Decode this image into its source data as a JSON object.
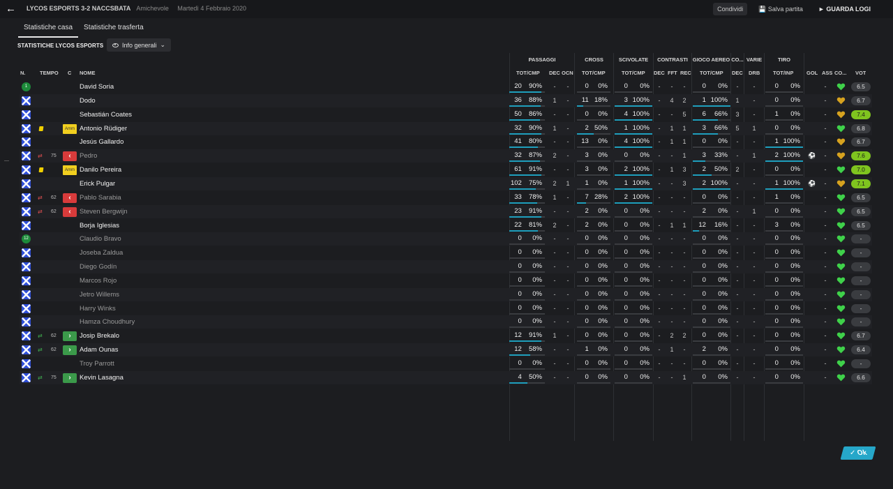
{
  "header": {
    "match_title": "LYCOS ESPORTS 3-2 NACCSBATA",
    "match_type": "Amichevole",
    "match_date": "Martedì 4 Febbraio 2020",
    "share_label": "Condividi",
    "save_label": "Salva partita",
    "watch_label": "GUARDA LOGI"
  },
  "tabs": [
    {
      "label": "Statistiche casa",
      "active": true
    },
    {
      "label": "Statistiche trasferta",
      "active": false
    }
  ],
  "section_title": "STATISTICHE LYCOS ESPORTS",
  "view_dropdown": {
    "label": "Info generali"
  },
  "groups": {
    "passaggi": "PASSAGGI",
    "cross": "CROSS",
    "scivolate": "SCIVOLATE",
    "contrasti": "CONTRASTI",
    "gioco_aereo": "GIOCO AEREO",
    "co": "CO...",
    "varie": "VARIE",
    "tiro": "TIRO"
  },
  "columns": {
    "n": "N.",
    "tempo": "TEMPO",
    "c": "C",
    "nome": "NOME",
    "pass_totcmp": "TOT/CMP",
    "pass_dec": "DEC",
    "pass_ocn": "OCN",
    "cross_totcmp": "TOT/CMP",
    "sciv_totcmp": "TOT/CMP",
    "contr_dec": "DEC",
    "contr_fft": "FFT",
    "contr_rec": "REC",
    "aereo_totcmp": "TOT/CMP",
    "co_dec": "DEC",
    "varie_drb": "DRB",
    "tiro_totinp": "TOT/INP",
    "gol": "GOL",
    "ass": "ASS",
    "co": "CO...",
    "vot": "VOT"
  },
  "colors": {
    "bar": "#1e9fbd",
    "rating_good": "#7fc41f",
    "heart_green": "#3fd14a",
    "heart_gold": "#d6a21f",
    "sub_out": "#d83b3b",
    "sub_in": "#3b9a4a"
  },
  "players": [
    {
      "num_badge": "1",
      "tempo_icon": "",
      "minute": "",
      "c": "",
      "name": "David Soria",
      "dim": false,
      "pass": [
        "20",
        "90%"
      ],
      "pass_pct": 90,
      "pass_dec": "-",
      "pass_ocn": "-",
      "cross": [
        "0",
        "0%"
      ],
      "cross_pct": 0,
      "sciv": [
        "0",
        "0%"
      ],
      "sciv_pct": 0,
      "c_dec": "-",
      "c_fft": "-",
      "c_rec": "-",
      "aereo": [
        "0",
        "0%"
      ],
      "aereo_pct": 0,
      "co_dec": "-",
      "drb": "-",
      "tiro": [
        "0",
        "0%"
      ],
      "tiro_pct": 0,
      "gol": "",
      "ass": "-",
      "heart": "green",
      "vot": "6.5",
      "vot_good": false
    },
    {
      "num_badge": "",
      "tempo_icon": "",
      "minute": "",
      "c": "",
      "name": "Dodo",
      "dim": false,
      "pass": [
        "36",
        "88%"
      ],
      "pass_pct": 88,
      "pass_dec": "1",
      "pass_ocn": "-",
      "cross": [
        "11",
        "18%"
      ],
      "cross_pct": 18,
      "sciv": [
        "3",
        "100%"
      ],
      "sciv_pct": 100,
      "c_dec": "-",
      "c_fft": "4",
      "c_rec": "2",
      "aereo": [
        "1",
        "100%"
      ],
      "aereo_pct": 100,
      "co_dec": "1",
      "drb": "-",
      "tiro": [
        "0",
        "0%"
      ],
      "tiro_pct": 0,
      "gol": "",
      "ass": "-",
      "heart": "gold",
      "vot": "6.7",
      "vot_good": false
    },
    {
      "num_badge": "",
      "tempo_icon": "",
      "minute": "",
      "c": "",
      "name": "Sebastián Coates",
      "dim": false,
      "pass": [
        "50",
        "86%"
      ],
      "pass_pct": 86,
      "pass_dec": "-",
      "pass_ocn": "-",
      "cross": [
        "0",
        "0%"
      ],
      "cross_pct": 0,
      "sciv": [
        "4",
        "100%"
      ],
      "sciv_pct": 100,
      "c_dec": "-",
      "c_fft": "-",
      "c_rec": "5",
      "aereo": [
        "6",
        "66%"
      ],
      "aereo_pct": 66,
      "co_dec": "3",
      "drb": "-",
      "tiro": [
        "1",
        "0%"
      ],
      "tiro_pct": 0,
      "gol": "",
      "ass": "-",
      "heart": "gold",
      "vot": "7.4",
      "vot_good": true
    },
    {
      "num_badge": "",
      "tempo_icon": "yellow",
      "minute": "",
      "c": "Amm",
      "name": "Antonio Rüdiger",
      "dim": false,
      "pass": [
        "32",
        "90%"
      ],
      "pass_pct": 90,
      "pass_dec": "1",
      "pass_ocn": "-",
      "cross": [
        "2",
        "50%"
      ],
      "cross_pct": 50,
      "sciv": [
        "1",
        "100%"
      ],
      "sciv_pct": 100,
      "c_dec": "-",
      "c_fft": "1",
      "c_rec": "1",
      "aereo": [
        "3",
        "66%"
      ],
      "aereo_pct": 66,
      "co_dec": "5",
      "drb": "1",
      "tiro": [
        "0",
        "0%"
      ],
      "tiro_pct": 0,
      "gol": "",
      "ass": "-",
      "heart": "green",
      "vot": "6.8",
      "vot_good": false
    },
    {
      "num_badge": "",
      "tempo_icon": "",
      "minute": "",
      "c": "",
      "name": "Jesús Gallardo",
      "dim": false,
      "pass": [
        "41",
        "80%"
      ],
      "pass_pct": 80,
      "pass_dec": "-",
      "pass_ocn": "-",
      "cross": [
        "13",
        "0%"
      ],
      "cross_pct": 0,
      "sciv": [
        "4",
        "100%"
      ],
      "sciv_pct": 100,
      "c_dec": "-",
      "c_fft": "1",
      "c_rec": "1",
      "aereo": [
        "0",
        "0%"
      ],
      "aereo_pct": 0,
      "co_dec": "-",
      "drb": "-",
      "tiro": [
        "1",
        "100%"
      ],
      "tiro_pct": 100,
      "gol": "",
      "ass": "-",
      "heart": "gold",
      "vot": "6.7",
      "vot_good": false
    },
    {
      "num_badge": "",
      "tempo_icon": "out",
      "minute": "75",
      "c": "out",
      "name": "Pedro",
      "dim": true,
      "pass": [
        "32",
        "87%"
      ],
      "pass_pct": 87,
      "pass_dec": "2",
      "pass_ocn": "-",
      "cross": [
        "3",
        "0%"
      ],
      "cross_pct": 0,
      "sciv": [
        "0",
        "0%"
      ],
      "sciv_pct": 0,
      "c_dec": "-",
      "c_fft": "-",
      "c_rec": "1",
      "aereo": [
        "3",
        "33%"
      ],
      "aereo_pct": 33,
      "co_dec": "-",
      "drb": "1",
      "tiro": [
        "2",
        "100%"
      ],
      "tiro_pct": 100,
      "gol": "ball",
      "ass": "-",
      "heart": "gold",
      "vot": "7.6",
      "vot_good": true
    },
    {
      "num_badge": "",
      "tempo_icon": "yellow",
      "minute": "",
      "c": "Amm",
      "name": "Danilo Pereira",
      "dim": false,
      "pass": [
        "61",
        "91%"
      ],
      "pass_pct": 91,
      "pass_dec": "-",
      "pass_ocn": "-",
      "cross": [
        "3",
        "0%"
      ],
      "cross_pct": 0,
      "sciv": [
        "2",
        "100%"
      ],
      "sciv_pct": 100,
      "c_dec": "-",
      "c_fft": "1",
      "c_rec": "3",
      "aereo": [
        "2",
        "50%"
      ],
      "aereo_pct": 50,
      "co_dec": "2",
      "drb": "-",
      "tiro": [
        "0",
        "0%"
      ],
      "tiro_pct": 0,
      "gol": "",
      "ass": "-",
      "heart": "green",
      "vot": "7.0",
      "vot_good": true
    },
    {
      "num_badge": "",
      "tempo_icon": "",
      "minute": "",
      "c": "",
      "name": "Erick Pulgar",
      "dim": false,
      "pass": [
        "102",
        "75%"
      ],
      "pass_pct": 75,
      "pass_dec": "2",
      "pass_ocn": "1",
      "cross": [
        "1",
        "0%"
      ],
      "cross_pct": 0,
      "sciv": [
        "1",
        "100%"
      ],
      "sciv_pct": 100,
      "c_dec": "-",
      "c_fft": "-",
      "c_rec": "3",
      "aereo": [
        "2",
        "100%"
      ],
      "aereo_pct": 100,
      "co_dec": "-",
      "drb": "-",
      "tiro": [
        "1",
        "100%"
      ],
      "tiro_pct": 100,
      "gol": "ball",
      "ass": "-",
      "heart": "gold",
      "vot": "7.1",
      "vot_good": true
    },
    {
      "num_badge": "",
      "tempo_icon": "out",
      "minute": "62",
      "c": "out",
      "name": "Pablo Sarabia",
      "dim": true,
      "pass": [
        "33",
        "78%"
      ],
      "pass_pct": 78,
      "pass_dec": "1",
      "pass_ocn": "-",
      "cross": [
        "7",
        "28%"
      ],
      "cross_pct": 28,
      "sciv": [
        "2",
        "100%"
      ],
      "sciv_pct": 100,
      "c_dec": "-",
      "c_fft": "-",
      "c_rec": "-",
      "aereo": [
        "0",
        "0%"
      ],
      "aereo_pct": 0,
      "co_dec": "-",
      "drb": "-",
      "tiro": [
        "1",
        "0%"
      ],
      "tiro_pct": 0,
      "gol": "",
      "ass": "-",
      "heart": "green",
      "vot": "6.5",
      "vot_good": false
    },
    {
      "num_badge": "",
      "tempo_icon": "out",
      "minute": "62",
      "c": "out",
      "name": "Steven Bergwijn",
      "dim": true,
      "pass": [
        "23",
        "91%"
      ],
      "pass_pct": 91,
      "pass_dec": "-",
      "pass_ocn": "-",
      "cross": [
        "2",
        "0%"
      ],
      "cross_pct": 0,
      "sciv": [
        "0",
        "0%"
      ],
      "sciv_pct": 0,
      "c_dec": "-",
      "c_fft": "-",
      "c_rec": "-",
      "aereo": [
        "2",
        "0%"
      ],
      "aereo_pct": 0,
      "co_dec": "-",
      "drb": "1",
      "tiro": [
        "0",
        "0%"
      ],
      "tiro_pct": 0,
      "gol": "",
      "ass": "-",
      "heart": "green",
      "vot": "6.5",
      "vot_good": false
    },
    {
      "num_badge": "",
      "tempo_icon": "",
      "minute": "",
      "c": "",
      "name": "Borja Iglesias",
      "dim": false,
      "pass": [
        "22",
        "81%"
      ],
      "pass_pct": 81,
      "pass_dec": "2",
      "pass_ocn": "-",
      "cross": [
        "2",
        "0%"
      ],
      "cross_pct": 0,
      "sciv": [
        "0",
        "0%"
      ],
      "sciv_pct": 0,
      "c_dec": "-",
      "c_fft": "1",
      "c_rec": "1",
      "aereo": [
        "12",
        "16%"
      ],
      "aereo_pct": 16,
      "co_dec": "-",
      "drb": "-",
      "tiro": [
        "3",
        "0%"
      ],
      "tiro_pct": 0,
      "gol": "",
      "ass": "-",
      "heart": "green",
      "vot": "6.5",
      "vot_good": false
    },
    {
      "num_badge": "12",
      "tempo_icon": "",
      "minute": "",
      "c": "",
      "name": "Claudio Bravo",
      "dim": true,
      "pass": [
        "0",
        "0%"
      ],
      "pass_pct": 0,
      "pass_dec": "-",
      "pass_ocn": "-",
      "cross": [
        "0",
        "0%"
      ],
      "cross_pct": 0,
      "sciv": [
        "0",
        "0%"
      ],
      "sciv_pct": 0,
      "c_dec": "-",
      "c_fft": "-",
      "c_rec": "-",
      "aereo": [
        "0",
        "0%"
      ],
      "aereo_pct": 0,
      "co_dec": "-",
      "drb": "-",
      "tiro": [
        "0",
        "0%"
      ],
      "tiro_pct": 0,
      "gol": "",
      "ass": "-",
      "heart": "green",
      "vot": "-",
      "vot_good": false
    },
    {
      "num_badge": "",
      "tempo_icon": "",
      "minute": "",
      "c": "",
      "name": "Joseba Zaldua",
      "dim": true,
      "pass": [
        "0",
        "0%"
      ],
      "pass_pct": 0,
      "pass_dec": "-",
      "pass_ocn": "-",
      "cross": [
        "0",
        "0%"
      ],
      "cross_pct": 0,
      "sciv": [
        "0",
        "0%"
      ],
      "sciv_pct": 0,
      "c_dec": "-",
      "c_fft": "-",
      "c_rec": "-",
      "aereo": [
        "0",
        "0%"
      ],
      "aereo_pct": 0,
      "co_dec": "-",
      "drb": "-",
      "tiro": [
        "0",
        "0%"
      ],
      "tiro_pct": 0,
      "gol": "",
      "ass": "-",
      "heart": "green",
      "vot": "-",
      "vot_good": false
    },
    {
      "num_badge": "",
      "tempo_icon": "",
      "minute": "",
      "c": "",
      "name": "Diego Godín",
      "dim": true,
      "pass": [
        "0",
        "0%"
      ],
      "pass_pct": 0,
      "pass_dec": "-",
      "pass_ocn": "-",
      "cross": [
        "0",
        "0%"
      ],
      "cross_pct": 0,
      "sciv": [
        "0",
        "0%"
      ],
      "sciv_pct": 0,
      "c_dec": "-",
      "c_fft": "-",
      "c_rec": "-",
      "aereo": [
        "0",
        "0%"
      ],
      "aereo_pct": 0,
      "co_dec": "-",
      "drb": "-",
      "tiro": [
        "0",
        "0%"
      ],
      "tiro_pct": 0,
      "gol": "",
      "ass": "-",
      "heart": "green",
      "vot": "-",
      "vot_good": false
    },
    {
      "num_badge": "",
      "tempo_icon": "",
      "minute": "",
      "c": "",
      "name": "Marcos Rojo",
      "dim": true,
      "pass": [
        "0",
        "0%"
      ],
      "pass_pct": 0,
      "pass_dec": "-",
      "pass_ocn": "-",
      "cross": [
        "0",
        "0%"
      ],
      "cross_pct": 0,
      "sciv": [
        "0",
        "0%"
      ],
      "sciv_pct": 0,
      "c_dec": "-",
      "c_fft": "-",
      "c_rec": "-",
      "aereo": [
        "0",
        "0%"
      ],
      "aereo_pct": 0,
      "co_dec": "-",
      "drb": "-",
      "tiro": [
        "0",
        "0%"
      ],
      "tiro_pct": 0,
      "gol": "",
      "ass": "-",
      "heart": "green",
      "vot": "-",
      "vot_good": false
    },
    {
      "num_badge": "",
      "tempo_icon": "",
      "minute": "",
      "c": "",
      "name": "Jetro Willems",
      "dim": true,
      "pass": [
        "0",
        "0%"
      ],
      "pass_pct": 0,
      "pass_dec": "-",
      "pass_ocn": "-",
      "cross": [
        "0",
        "0%"
      ],
      "cross_pct": 0,
      "sciv": [
        "0",
        "0%"
      ],
      "sciv_pct": 0,
      "c_dec": "-",
      "c_fft": "-",
      "c_rec": "-",
      "aereo": [
        "0",
        "0%"
      ],
      "aereo_pct": 0,
      "co_dec": "-",
      "drb": "-",
      "tiro": [
        "0",
        "0%"
      ],
      "tiro_pct": 0,
      "gol": "",
      "ass": "-",
      "heart": "green",
      "vot": "-",
      "vot_good": false
    },
    {
      "num_badge": "",
      "tempo_icon": "",
      "minute": "",
      "c": "",
      "name": "Harry Winks",
      "dim": true,
      "pass": [
        "0",
        "0%"
      ],
      "pass_pct": 0,
      "pass_dec": "-",
      "pass_ocn": "-",
      "cross": [
        "0",
        "0%"
      ],
      "cross_pct": 0,
      "sciv": [
        "0",
        "0%"
      ],
      "sciv_pct": 0,
      "c_dec": "-",
      "c_fft": "-",
      "c_rec": "-",
      "aereo": [
        "0",
        "0%"
      ],
      "aereo_pct": 0,
      "co_dec": "-",
      "drb": "-",
      "tiro": [
        "0",
        "0%"
      ],
      "tiro_pct": 0,
      "gol": "",
      "ass": "-",
      "heart": "green",
      "vot": "-",
      "vot_good": false
    },
    {
      "num_badge": "",
      "tempo_icon": "",
      "minute": "",
      "c": "",
      "name": "Hamza Choudhury",
      "dim": true,
      "pass": [
        "0",
        "0%"
      ],
      "pass_pct": 0,
      "pass_dec": "-",
      "pass_ocn": "-",
      "cross": [
        "0",
        "0%"
      ],
      "cross_pct": 0,
      "sciv": [
        "0",
        "0%"
      ],
      "sciv_pct": 0,
      "c_dec": "-",
      "c_fft": "-",
      "c_rec": "-",
      "aereo": [
        "0",
        "0%"
      ],
      "aereo_pct": 0,
      "co_dec": "-",
      "drb": "-",
      "tiro": [
        "0",
        "0%"
      ],
      "tiro_pct": 0,
      "gol": "",
      "ass": "-",
      "heart": "green",
      "vot": "-",
      "vot_good": false
    },
    {
      "num_badge": "",
      "tempo_icon": "in",
      "minute": "62",
      "c": "in",
      "name": "Josip Brekalo",
      "dim": false,
      "pass": [
        "12",
        "91%"
      ],
      "pass_pct": 91,
      "pass_dec": "1",
      "pass_ocn": "-",
      "cross": [
        "0",
        "0%"
      ],
      "cross_pct": 0,
      "sciv": [
        "0",
        "0%"
      ],
      "sciv_pct": 0,
      "c_dec": "-",
      "c_fft": "2",
      "c_rec": "2",
      "aereo": [
        "0",
        "0%"
      ],
      "aereo_pct": 0,
      "co_dec": "-",
      "drb": "-",
      "tiro": [
        "0",
        "0%"
      ],
      "tiro_pct": 0,
      "gol": "",
      "ass": "-",
      "heart": "green",
      "vot": "6.7",
      "vot_good": false
    },
    {
      "num_badge": "",
      "tempo_icon": "in",
      "minute": "62",
      "c": "in",
      "name": "Adam Ounas",
      "dim": false,
      "pass": [
        "12",
        "58%"
      ],
      "pass_pct": 58,
      "pass_dec": "-",
      "pass_ocn": "-",
      "cross": [
        "1",
        "0%"
      ],
      "cross_pct": 0,
      "sciv": [
        "0",
        "0%"
      ],
      "sciv_pct": 0,
      "c_dec": "-",
      "c_fft": "1",
      "c_rec": "-",
      "aereo": [
        "2",
        "0%"
      ],
      "aereo_pct": 0,
      "co_dec": "-",
      "drb": "-",
      "tiro": [
        "0",
        "0%"
      ],
      "tiro_pct": 0,
      "gol": "",
      "ass": "-",
      "heart": "green",
      "vot": "6.4",
      "vot_good": false
    },
    {
      "num_badge": "",
      "tempo_icon": "",
      "minute": "",
      "c": "",
      "name": "Troy Parrott",
      "dim": true,
      "pass": [
        "0",
        "0%"
      ],
      "pass_pct": 0,
      "pass_dec": "-",
      "pass_ocn": "-",
      "cross": [
        "0",
        "0%"
      ],
      "cross_pct": 0,
      "sciv": [
        "0",
        "0%"
      ],
      "sciv_pct": 0,
      "c_dec": "-",
      "c_fft": "-",
      "c_rec": "-",
      "aereo": [
        "0",
        "0%"
      ],
      "aereo_pct": 0,
      "co_dec": "-",
      "drb": "-",
      "tiro": [
        "0",
        "0%"
      ],
      "tiro_pct": 0,
      "gol": "",
      "ass": "-",
      "heart": "green",
      "vot": "-",
      "vot_good": false
    },
    {
      "num_badge": "",
      "tempo_icon": "in",
      "minute": "75",
      "c": "in",
      "name": "Kevin Lasagna",
      "dim": false,
      "pass": [
        "4",
        "50%"
      ],
      "pass_pct": 50,
      "pass_dec": "-",
      "pass_ocn": "-",
      "cross": [
        "0",
        "0%"
      ],
      "cross_pct": 0,
      "sciv": [
        "0",
        "0%"
      ],
      "sciv_pct": 0,
      "c_dec": "-",
      "c_fft": "-",
      "c_rec": "1",
      "aereo": [
        "0",
        "0%"
      ],
      "aereo_pct": 0,
      "co_dec": "-",
      "drb": "-",
      "tiro": [
        "0",
        "0%"
      ],
      "tiro_pct": 0,
      "gol": "",
      "ass": "-",
      "heart": "green",
      "vot": "6.6",
      "vot_good": false
    }
  ],
  "ok_label": "Ok"
}
